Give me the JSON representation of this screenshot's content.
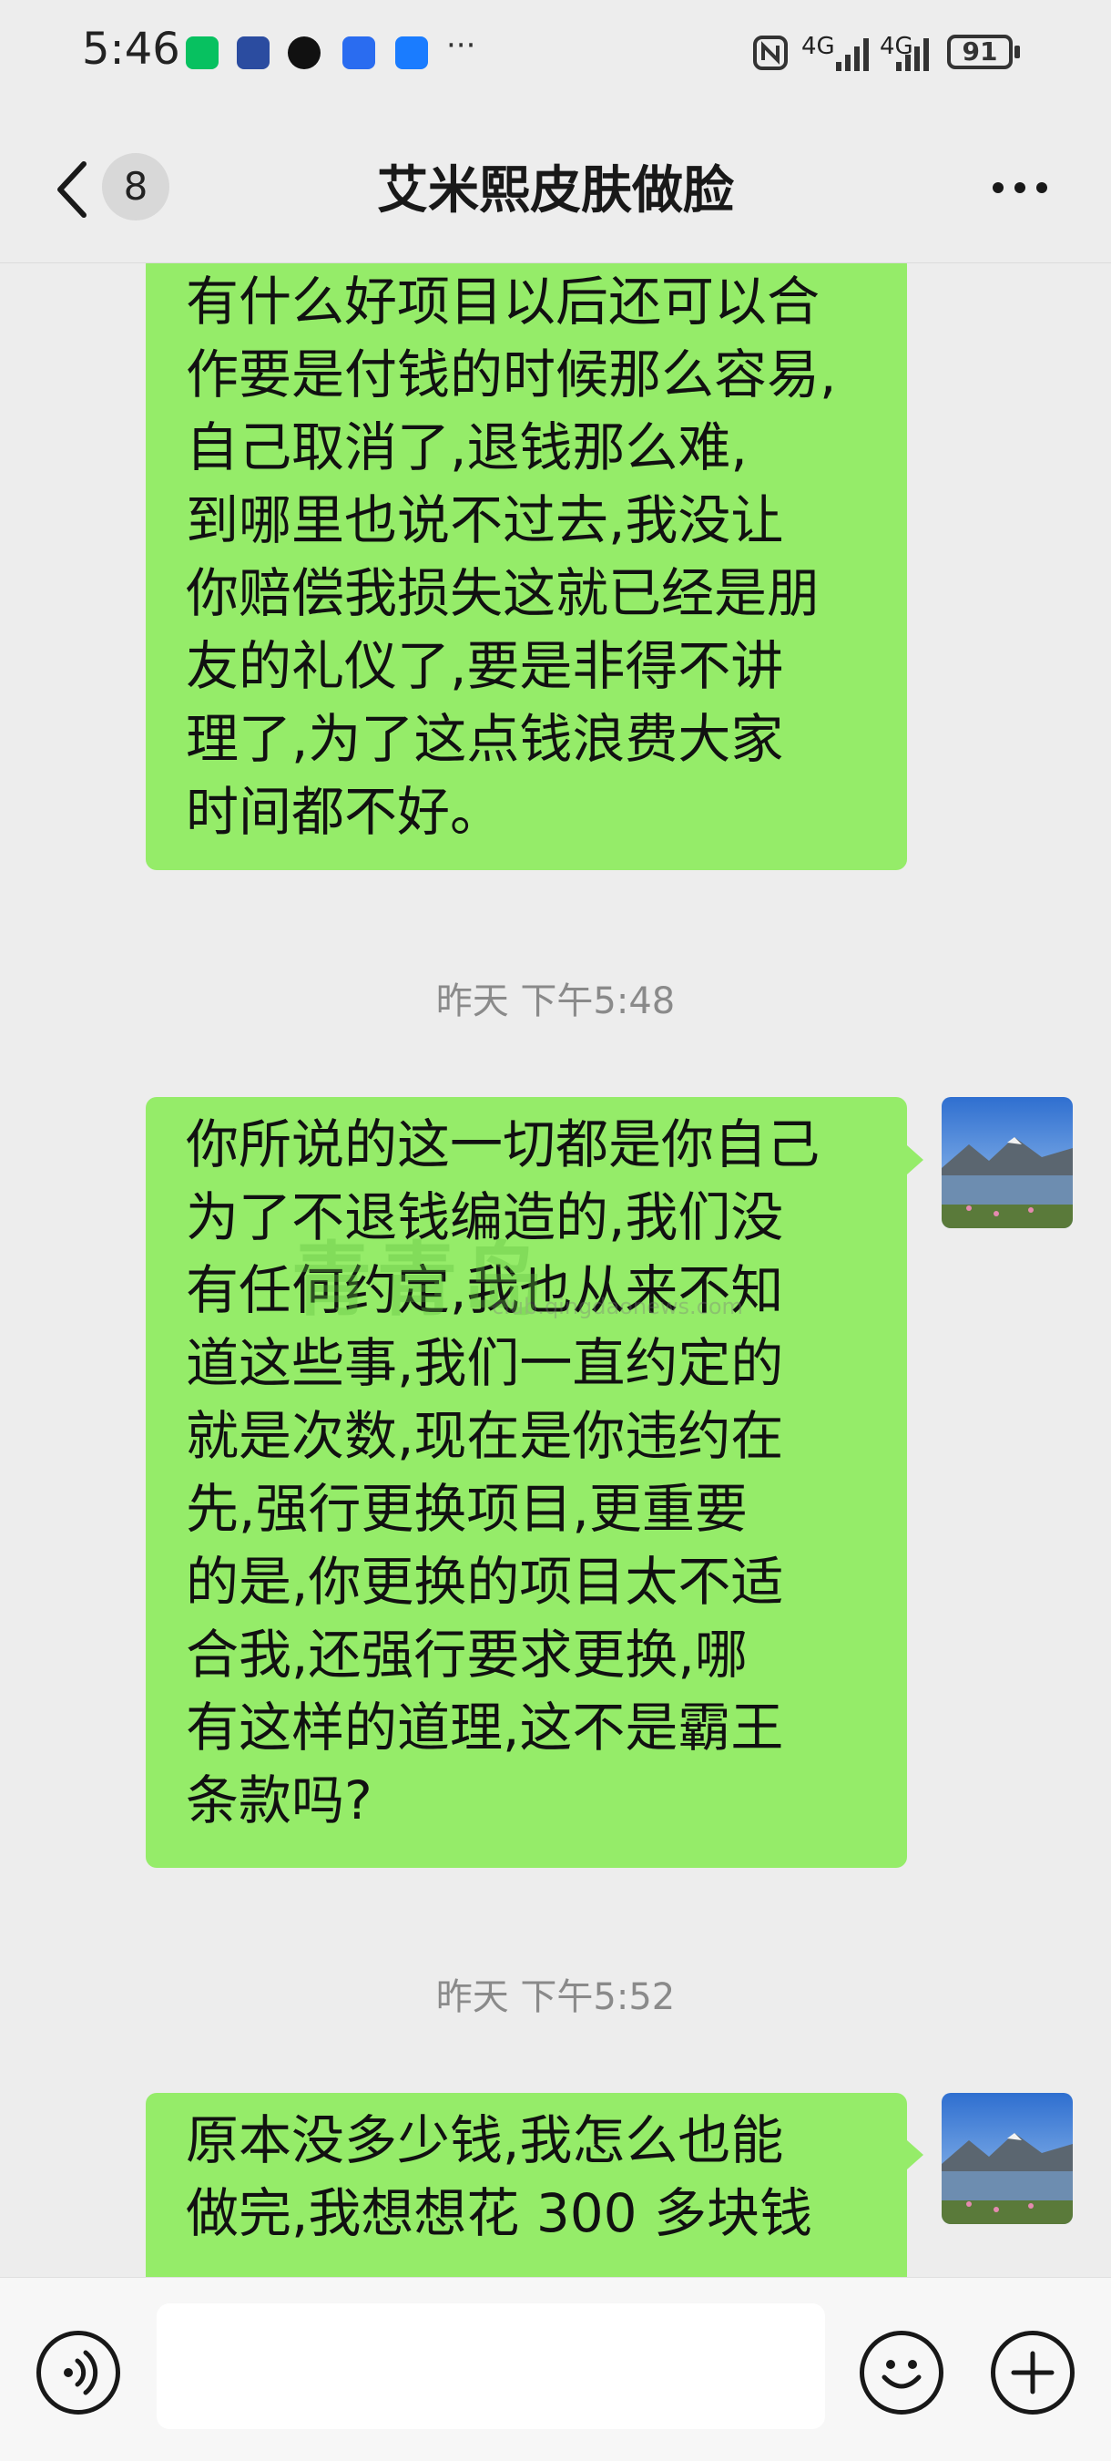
{
  "status_bar": {
    "time": "5:46",
    "app_icons": [
      "wechat-icon",
      "1688-icon",
      "qq-icon",
      "voice-app-icon",
      "blue-app-icon"
    ],
    "more_notifications": "···",
    "network": "4G",
    "battery": "91"
  },
  "header": {
    "back_label": "<",
    "unread_count": "8",
    "title": "艾米熙皮肤做脸",
    "more_label": "···"
  },
  "messages": [
    {
      "type": "sent",
      "text": "有什么好项目以后还可以合\n作要是付钱的时候那么容易,\n自己取消了,退钱那么难,\n到哪里也说不过去,我没让\n你赔偿我损失这就已经是朋\n友的礼仪了,要是非得不讲\n理了,为了这点钱浪费大家\n时间都不好。"
    },
    {
      "type": "timestamp",
      "text": "昨天 下午5:48"
    },
    {
      "type": "received",
      "text": "你所说的这一切都是你自己\n为了不退钱编造的,我们没\n有任何约定,我也从来不知\n道这些事,我们一直约定的\n就是次数,现在是你违约在\n先,强行更换项目,更重要\n的是,你更换的项目太不适\n合我,还强行要求更换,哪\n有这样的道理,这不是霸王\n条款吗?"
    },
    {
      "type": "timestamp",
      "text": "昨天 下午5:52"
    },
    {
      "type": "received",
      "text": "原本没多少钱,我怎么也能\n做完,我想想花 300 多块钱"
    }
  ],
  "watermark": {
    "main": "青青岛",
    "sub": "club.qingdaonews.com"
  },
  "input_bar": {
    "voice_icon": "voice-icon",
    "input_value": "",
    "emoji_icon": "emoji-icon",
    "plus_icon": "plus-icon"
  },
  "colors": {
    "bubble": "#95ec69",
    "background": "#ededed",
    "timestamp": "#8a8a8a"
  }
}
